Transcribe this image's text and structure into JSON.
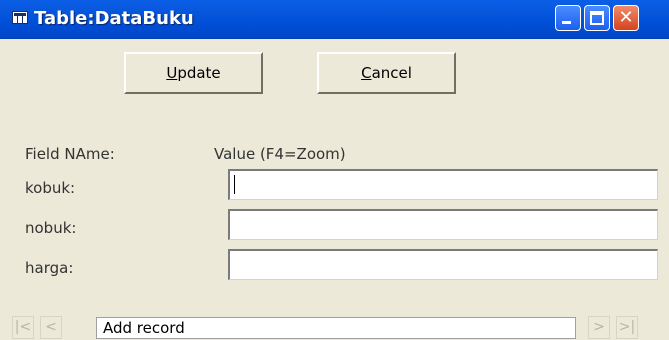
{
  "window": {
    "title": "Table:DataBuku"
  },
  "buttons": {
    "update_prefix": "U",
    "update_rest": "pdate",
    "cancel_prefix": "C",
    "cancel_rest": "ancel"
  },
  "form": {
    "field_header": "Field NAme:",
    "value_header": "Value (F4=Zoom)",
    "fields": [
      {
        "label": "kobuk:",
        "value": ""
      },
      {
        "label": "nobuk:",
        "value": ""
      },
      {
        "label": "harga:",
        "value": ""
      }
    ]
  },
  "navigator": {
    "status": "Add record",
    "first": "|<",
    "prev": "<",
    "next": ">",
    "last": ">|"
  },
  "colors": {
    "titlebar": "#0054e3",
    "window_bg": "#ece9d8",
    "close_button": "#d4431f"
  }
}
